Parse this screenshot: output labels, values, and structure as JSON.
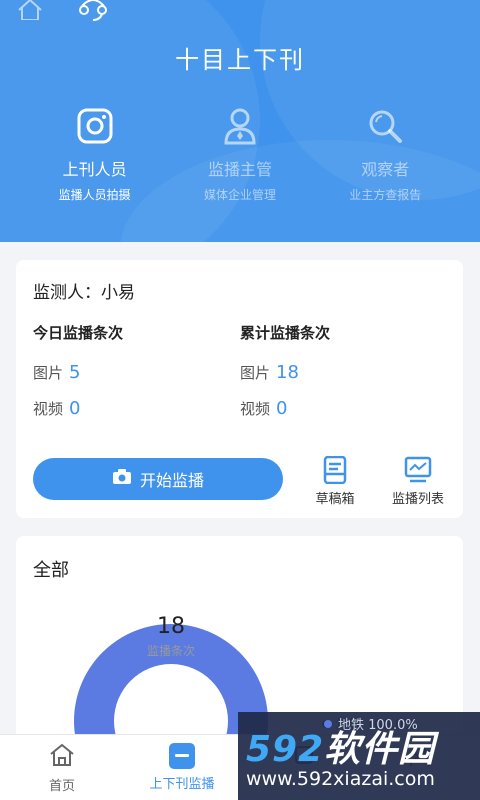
{
  "header": {
    "title": "十目上下刊",
    "roles": [
      {
        "icon": "camera-icon",
        "name": "上刊人员",
        "desc": "监播人员拍摄",
        "active": true
      },
      {
        "icon": "manager-icon",
        "name": "监播主管",
        "desc": "媒体企业管理",
        "active": false
      },
      {
        "icon": "magnifier-icon",
        "name": "观察者",
        "desc": "业主方查报告",
        "active": false
      }
    ]
  },
  "summary": {
    "monitor_label": "监测人：小易",
    "today_title": "今日监播条次",
    "total_title": "累计监播条次",
    "image_label": "图片",
    "video_label": "视频",
    "today_images": "5",
    "today_videos": "0",
    "total_images": "18",
    "total_videos": "0",
    "start_button": "开始监播",
    "drafts_label": "草稿箱",
    "list_label": "监播列表"
  },
  "overview": {
    "title": "全部",
    "center_value": "18",
    "legend_label": "地铁 100.0%"
  },
  "chart_data": {
    "type": "pie",
    "categories": [
      "地铁"
    ],
    "values": [
      100.0
    ],
    "total": 18
  },
  "tabbar": {
    "items": [
      {
        "label": "首页",
        "icon": "home-icon"
      },
      {
        "label": "上下刊监播",
        "icon": "publish-icon",
        "active": true
      }
    ]
  },
  "watermark": {
    "brand_num": "592",
    "brand_text": "软件园",
    "url": "www.592xiazai.com"
  },
  "colors": {
    "accent": "#3f93ec",
    "donut": "#5b7be2"
  }
}
